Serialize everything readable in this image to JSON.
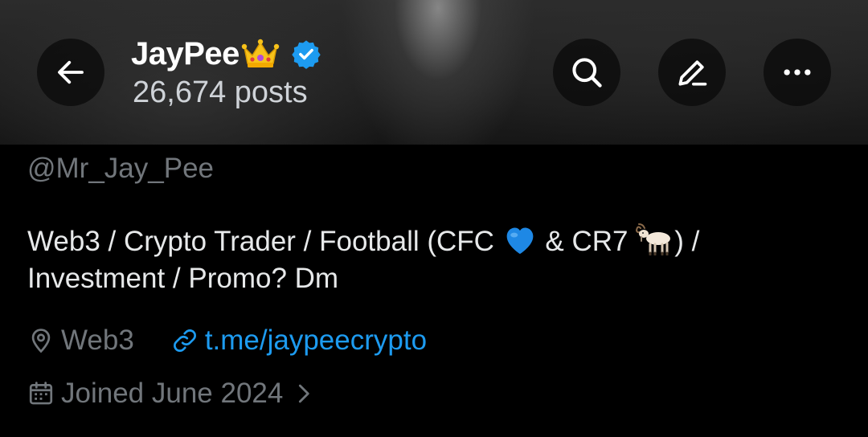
{
  "profile": {
    "display_name": "JayPee",
    "post_count": "26,674 posts",
    "handle": "@Mr_Jay_Pee",
    "bio": {
      "part1": "Web3 / Crypto Trader / Football (CFC ",
      "part2": " & CR7 ",
      "part3": ") /",
      "line2": "Investment / Promo? Dm"
    },
    "location": "Web3",
    "website": "t.me/jaypeecrypto",
    "joined": "Joined June 2024"
  },
  "icons": {
    "back": "arrow-left-icon",
    "search": "search-icon",
    "edit": "edit-pencil-icon",
    "more": "more-horizontal-icon",
    "verified": "verified-badge-icon",
    "crown": "crown-emoji",
    "heart": "blue-heart-emoji",
    "goat": "goat-emoji",
    "location": "location-pin-icon",
    "link": "link-icon",
    "calendar": "calendar-icon",
    "chevron": "chevron-right-icon"
  },
  "colors": {
    "background": "#000000",
    "primary_text": "#e7e9ea",
    "secondary_text": "#71767b",
    "link": "#1d9bf0",
    "verified": "#1d9bf0"
  }
}
